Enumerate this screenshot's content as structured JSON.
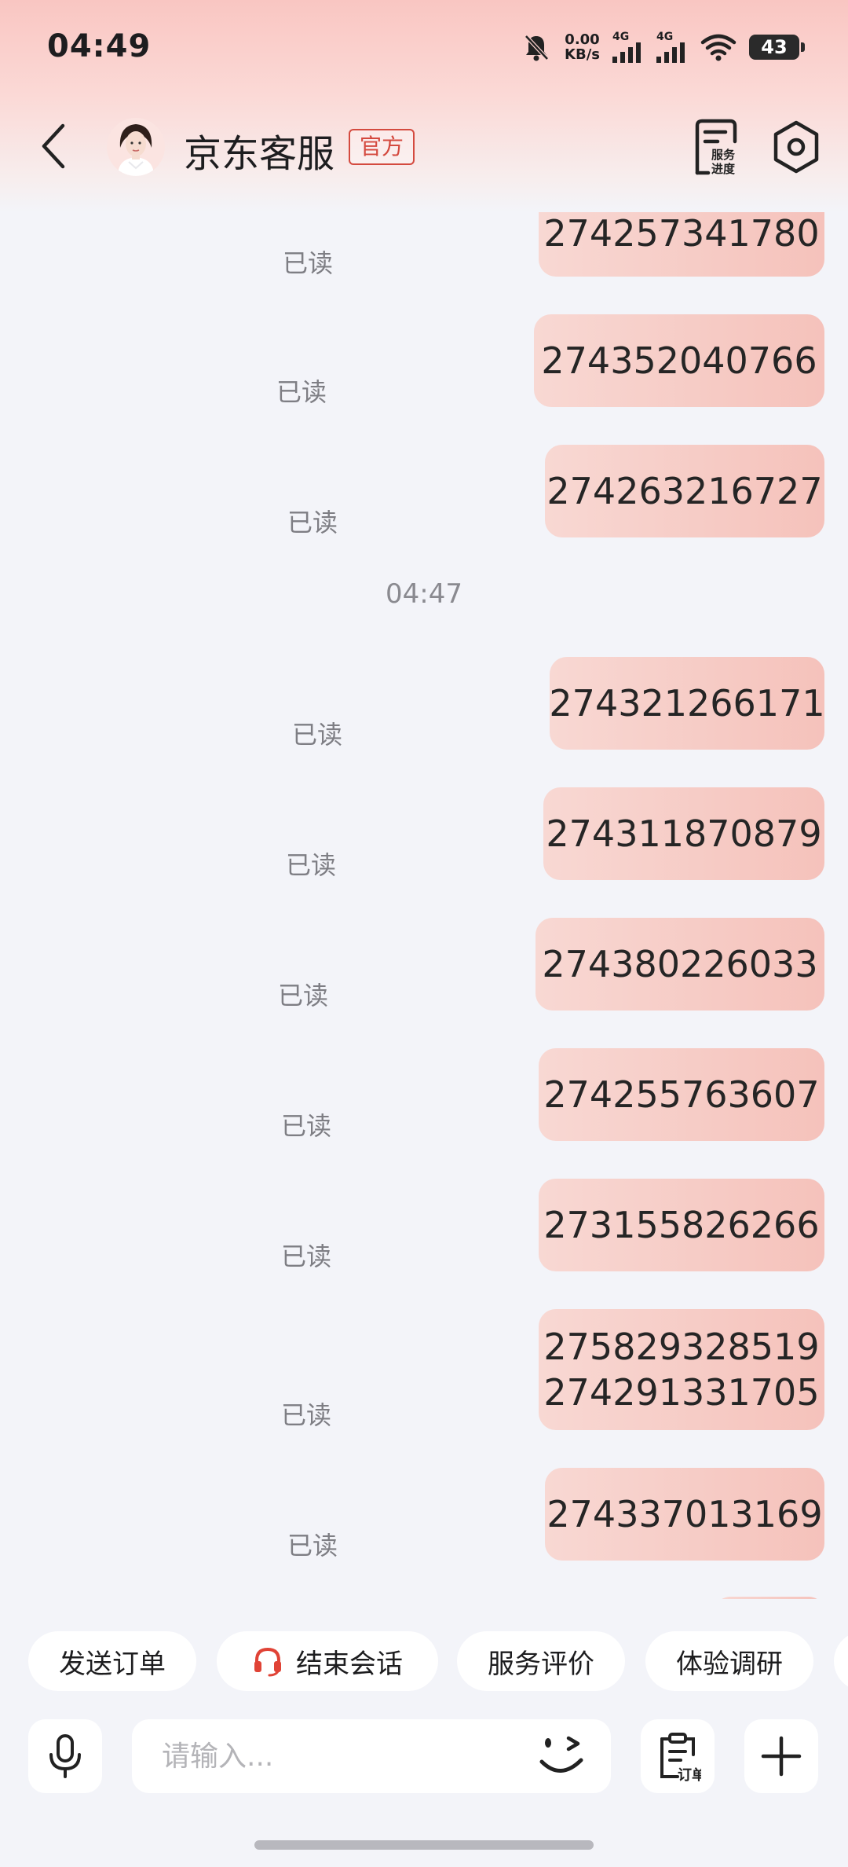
{
  "status_bar": {
    "time": "04:49",
    "net_speed_value": "0.00",
    "net_speed_unit": "KB/s",
    "signal1_label": "4G",
    "signal2_label": "4G",
    "battery": "43"
  },
  "header": {
    "title": "京东客服",
    "badge": "官方",
    "service_progress_label_line1": "服务",
    "service_progress_label_line2": "进度"
  },
  "chat": {
    "read_label": "已读",
    "timestamp": "04:47",
    "messages": [
      {
        "lines": [
          "274257341780"
        ]
      },
      {
        "lines": [
          "274352040766"
        ]
      },
      {
        "lines": [
          "274263216727"
        ]
      },
      {
        "lines": [
          "274321266171"
        ]
      },
      {
        "lines": [
          "274311870879"
        ]
      },
      {
        "lines": [
          "274380226033"
        ]
      },
      {
        "lines": [
          "274255763607"
        ]
      },
      {
        "lines": [
          "273155826266"
        ]
      },
      {
        "lines": [
          "275829328519",
          "274291331705"
        ]
      },
      {
        "lines": [
          "274337013169"
        ]
      }
    ]
  },
  "quick_actions": [
    {
      "label": "发送订单"
    },
    {
      "label": "结束会话",
      "icon": "headset-icon"
    },
    {
      "label": "服务评价"
    },
    {
      "label": "体验调研"
    }
  ],
  "input": {
    "placeholder": "请输入...",
    "order_button_label": "订单"
  },
  "colors": {
    "accent": "#d44a3f",
    "bubble": "#f6c9c3",
    "background": "#f3f4f9"
  }
}
